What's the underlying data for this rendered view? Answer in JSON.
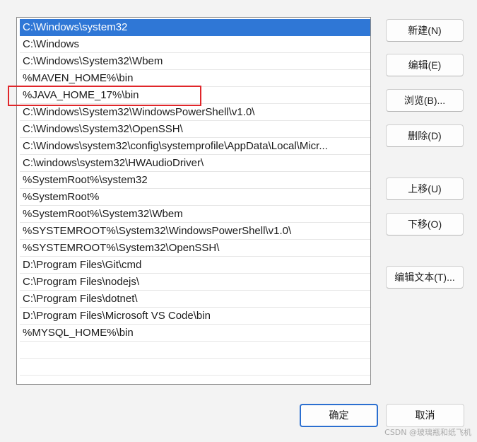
{
  "path_entries": [
    "C:\\Windows\\system32",
    "C:\\Windows",
    "C:\\Windows\\System32\\Wbem",
    "%MAVEN_HOME%\\bin",
    "%JAVA_HOME_17%\\bin",
    "C:\\Windows\\System32\\WindowsPowerShell\\v1.0\\",
    "C:\\Windows\\System32\\OpenSSH\\",
    "C:\\Windows\\system32\\config\\systemprofile\\AppData\\Local\\Micr...",
    "C:\\windows\\system32\\HWAudioDriver\\",
    "%SystemRoot%\\system32",
    "%SystemRoot%",
    "%SystemRoot%\\System32\\Wbem",
    "%SYSTEMROOT%\\System32\\WindowsPowerShell\\v1.0\\",
    "%SYSTEMROOT%\\System32\\OpenSSH\\",
    "D:\\Program Files\\Git\\cmd",
    "C:\\Program Files\\nodejs\\",
    "C:\\Program Files\\dotnet\\",
    "D:\\Program Files\\Microsoft VS Code\\bin",
    "%MYSQL_HOME%\\bin"
  ],
  "selected_index": 0,
  "highlighted_index": 4,
  "buttons": {
    "new": "新建(N)",
    "edit": "编辑(E)",
    "browse": "浏览(B)...",
    "delete": "删除(D)",
    "move_up": "上移(U)",
    "move_down": "下移(O)",
    "edit_text": "编辑文本(T)...",
    "ok": "确定",
    "cancel": "取消"
  },
  "watermark": "CSDN @玻璃瓶和纸飞机",
  "colors": {
    "selection": "#2f77d6",
    "highlight_box": "#e0262a",
    "default_button_border": "#2b6fd0"
  }
}
